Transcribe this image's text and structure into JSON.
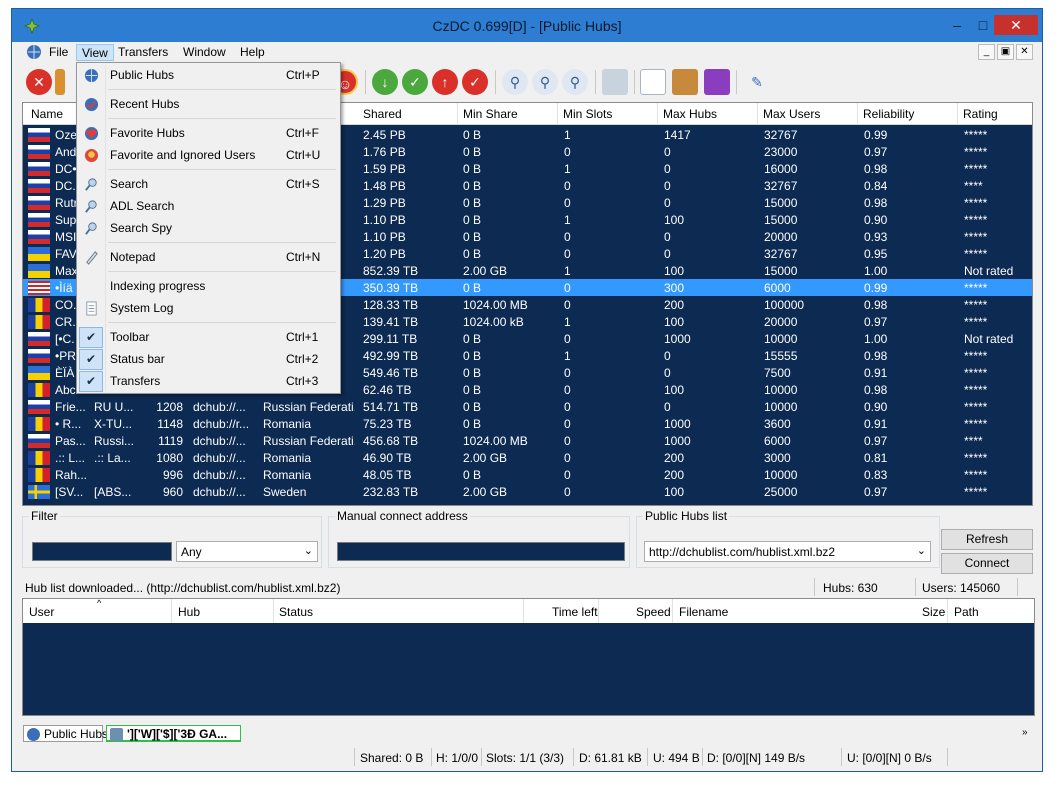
{
  "window": {
    "title": "CzDC 0.699[D] - [Public Hubs]",
    "min": "–",
    "max": "□",
    "close": "✕"
  },
  "menu": [
    "File",
    "View",
    "Transfers",
    "Window",
    "Help"
  ],
  "mdi_controls": [
    "_",
    "▣",
    "✕"
  ],
  "view_menu": {
    "items": [
      {
        "label": "Public Hubs",
        "shortcut": "Ctrl+P",
        "icon": "globe-icon"
      },
      {
        "label": "Recent Hubs",
        "shortcut": "",
        "icon": "recent-hubs-icon"
      },
      {
        "label": "Favorite Hubs",
        "shortcut": "Ctrl+F",
        "icon": "heart-icon"
      },
      {
        "label": "Favorite and Ignored Users",
        "shortcut": "Ctrl+U",
        "icon": "user-icon"
      },
      {
        "label": "Search",
        "shortcut": "Ctrl+S",
        "icon": "search-icon"
      },
      {
        "label": "ADL Search",
        "shortcut": "",
        "icon": "adl-search-icon"
      },
      {
        "label": "Search Spy",
        "shortcut": "",
        "icon": "search-spy-icon"
      },
      {
        "label": "Notepad",
        "shortcut": "Ctrl+N",
        "icon": "notepad-icon"
      },
      {
        "label": "Indexing progress",
        "shortcut": "",
        "icon": ""
      },
      {
        "label": "System Log",
        "shortcut": "",
        "icon": "log-icon"
      },
      {
        "label": "Toolbar",
        "shortcut": "Ctrl+1",
        "checked": true
      },
      {
        "label": "Status bar",
        "shortcut": "Ctrl+2",
        "checked": true
      },
      {
        "label": "Transfers",
        "shortcut": "Ctrl+3",
        "checked": true
      }
    ],
    "check_glyph": "✔"
  },
  "hub_columns": [
    "Name",
    "Shared",
    "Min Share",
    "Min Slots",
    "Max Hubs",
    "Max Users",
    "Reliability",
    "Rating"
  ],
  "hubs": [
    {
      "flag": "ru",
      "name": "Ozer",
      "desc": "",
      "users": "",
      "addr": "",
      "country": "",
      "shared": "2.45 PB",
      "min_share": "0 B",
      "min_slots": "1",
      "max_hubs": "1417",
      "max_users": "32767",
      "reliability": "0.99",
      "rating": "*****"
    },
    {
      "flag": "ru",
      "name": "And",
      "desc": "",
      "users": "",
      "addr": "",
      "country": "",
      "shared": "1.76 PB",
      "min_share": "0 B",
      "min_slots": "0",
      "max_hubs": "0",
      "max_users": "23000",
      "reliability": "0.97",
      "rating": "*****"
    },
    {
      "flag": "ru",
      "name": "DC•",
      "desc": "",
      "users": "",
      "addr": "",
      "country": "",
      "shared": "1.59 PB",
      "min_share": "0 B",
      "min_slots": "1",
      "max_hubs": "0",
      "max_users": "16000",
      "reliability": "0.98",
      "rating": "*****"
    },
    {
      "flag": "ru",
      "name": "DC.",
      "desc": "",
      "users": "",
      "addr": "",
      "country": "",
      "shared": "1.48 PB",
      "min_share": "0 B",
      "min_slots": "0",
      "max_hubs": "0",
      "max_users": "32767",
      "reliability": "0.84",
      "rating": "****"
    },
    {
      "flag": "ru",
      "name": "Rutr",
      "desc": "",
      "users": "",
      "addr": "",
      "country": "",
      "shared": "1.29 PB",
      "min_share": "0 B",
      "min_slots": "0",
      "max_hubs": "0",
      "max_users": "15000",
      "reliability": "0.98",
      "rating": "*****"
    },
    {
      "flag": "ru",
      "name": "Sup",
      "desc": "",
      "users": "",
      "addr": "",
      "country": "",
      "shared": "1.10 PB",
      "min_share": "0 B",
      "min_slots": "1",
      "max_hubs": "100",
      "max_users": "15000",
      "reliability": "0.90",
      "rating": "*****"
    },
    {
      "flag": "ru",
      "name": "MSI",
      "desc": "",
      "users": "",
      "addr": "",
      "country": "",
      "shared": "1.10 PB",
      "min_share": "0 B",
      "min_slots": "0",
      "max_hubs": "0",
      "max_users": "20000",
      "reliability": "0.93",
      "rating": "*****"
    },
    {
      "flag": "ua",
      "name": "FAV",
      "desc": "",
      "users": "",
      "addr": "",
      "country": "",
      "shared": "1.20 PB",
      "min_share": "0 B",
      "min_slots": "0",
      "max_hubs": "0",
      "max_users": "32767",
      "reliability": "0.95",
      "rating": "*****"
    },
    {
      "flag": "ua",
      "name": "Max",
      "desc": "",
      "users": "",
      "addr": "",
      "country": "",
      "shared": "852.39 TB",
      "min_share": "2.00 GB",
      "min_slots": "1",
      "max_hubs": "100",
      "max_users": "15000",
      "reliability": "1.00",
      "rating": "Not rated"
    },
    {
      "flag": "us",
      "name": "•Ìíä",
      "desc": "",
      "users": "",
      "addr": "",
      "country": "",
      "shared": "350.39 TB",
      "min_share": "0 B",
      "min_slots": "0",
      "max_hubs": "300",
      "max_users": "6000",
      "reliability": "0.99",
      "rating": "*****",
      "selected": true
    },
    {
      "flag": "ro",
      "name": "CO.",
      "desc": "",
      "users": "",
      "addr": "",
      "country": "",
      "shared": "128.33 TB",
      "min_share": "1024.00 MB",
      "min_slots": "0",
      "max_hubs": "200",
      "max_users": "100000",
      "reliability": "0.98",
      "rating": "*****"
    },
    {
      "flag": "ro",
      "name": "CR.",
      "desc": "",
      "users": "",
      "addr": "",
      "country": "",
      "shared": "139.41 TB",
      "min_share": "1024.00 kB",
      "min_slots": "1",
      "max_hubs": "100",
      "max_users": "20000",
      "reliability": "0.97",
      "rating": "*****"
    },
    {
      "flag": "ru",
      "name": "[•C.",
      "desc": "",
      "users": "",
      "addr": "",
      "country": "",
      "shared": "299.11 TB",
      "min_share": "0 B",
      "min_slots": "0",
      "max_hubs": "1000",
      "max_users": "10000",
      "reliability": "1.00",
      "rating": "Not rated"
    },
    {
      "flag": "ru",
      "name": "•PR",
      "desc": "",
      "users": "",
      "addr": "",
      "country": "",
      "shared": "492.99 TB",
      "min_share": "0 B",
      "min_slots": "1",
      "max_hubs": "0",
      "max_users": "15555",
      "reliability": "0.98",
      "rating": "*****"
    },
    {
      "flag": "ua",
      "name": "ÈÏÀ",
      "desc": "",
      "users": "",
      "addr": "",
      "country": "",
      "shared": "549.46 TB",
      "min_share": "0 B",
      "min_slots": "0",
      "max_hubs": "0",
      "max_users": "7500",
      "reliability": "0.91",
      "rating": "*****"
    },
    {
      "flag": "ro",
      "name": "Abc",
      "desc": "",
      "users": "",
      "addr": "",
      "country": "",
      "shared": "62.46 TB",
      "min_share": "0 B",
      "min_slots": "0",
      "max_hubs": "100",
      "max_users": "10000",
      "reliability": "0.98",
      "rating": "*****"
    },
    {
      "flag": "ru",
      "name": "Frie...",
      "desc": "RU U...",
      "users": "1208",
      "addr": "dchub://...",
      "country": "Russian Federati...",
      "shared": "514.71 TB",
      "min_share": "0 B",
      "min_slots": "0",
      "max_hubs": "0",
      "max_users": "10000",
      "reliability": "0.90",
      "rating": "*****"
    },
    {
      "flag": "ro",
      "name": "• R...",
      "desc": "X-TU...",
      "users": "1148",
      "addr": "dchub://r...",
      "country": "Romania",
      "shared": "75.23 TB",
      "min_share": "0 B",
      "min_slots": "0",
      "max_hubs": "1000",
      "max_users": "3600",
      "reliability": "0.91",
      "rating": "*****"
    },
    {
      "flag": "ru",
      "name": "Pas...",
      "desc": "Russi...",
      "users": "1119",
      "addr": "dchub://...",
      "country": "Russian Federati...",
      "shared": "456.68 TB",
      "min_share": "1024.00 MB",
      "min_slots": "0",
      "max_hubs": "1000",
      "max_users": "6000",
      "reliability": "0.97",
      "rating": "****"
    },
    {
      "flag": "ro",
      "name": ".:: L...",
      "desc": ".:: La...",
      "users": "1080",
      "addr": "dchub://...",
      "country": "Romania",
      "shared": "46.90 TB",
      "min_share": "2.00 GB",
      "min_slots": "0",
      "max_hubs": "200",
      "max_users": "3000",
      "reliability": "0.81",
      "rating": "*****"
    },
    {
      "flag": "ro",
      "name": "Rah...",
      "desc": "",
      "users": "996",
      "addr": "dchub://...",
      "country": "Romania",
      "shared": "48.05 TB",
      "min_share": "0 B",
      "min_slots": "0",
      "max_hubs": "200",
      "max_users": "10000",
      "reliability": "0.83",
      "rating": "*****"
    },
    {
      "flag": "se",
      "name": "[SV...",
      "desc": "[ABS...",
      "users": "960",
      "addr": "dchub://...",
      "country": "Sweden",
      "shared": "232.83 TB",
      "min_share": "2.00 GB",
      "min_slots": "0",
      "max_hubs": "100",
      "max_users": "25000",
      "reliability": "0.97",
      "rating": "*****"
    }
  ],
  "filter": {
    "label": "Filter",
    "value": "",
    "select": "Any"
  },
  "manual": {
    "label": "Manual connect address",
    "value": ""
  },
  "publiclist": {
    "label": "Public Hubs list",
    "value": "http://dchublist.com/hublist.xml.bz2"
  },
  "buttons": {
    "refresh": "Refresh",
    "connect": "Connect"
  },
  "status": {
    "message": "Hub list downloaded... (http://dchublist.com/hublist.xml.bz2)",
    "hubs": "Hubs: 630",
    "users": "Users: 145060"
  },
  "transfer_columns": [
    "User",
    "Hub",
    "Status",
    "Time left",
    "Speed",
    "Filename",
    "Size",
    "Path"
  ],
  "tabs": [
    {
      "label": "Public Hubs"
    },
    {
      "label": "']['W]['$]['3Đ GA..."
    }
  ],
  "bottom": {
    "shared": "Shared: 0 B",
    "h": "H: 1/0/0",
    "slots": "Slots: 1/1 (3/3)",
    "d": "D: 61.81 kB",
    "u": "U: 494 B",
    "dl": "D: [0/0][N] 149 B/s",
    "ul": "U: [0/0][N] 0 B/s"
  },
  "colors": {
    "grid_bg": "#0c2a52",
    "selected": "#3399ff",
    "title_bar": "#2d7dd2"
  }
}
